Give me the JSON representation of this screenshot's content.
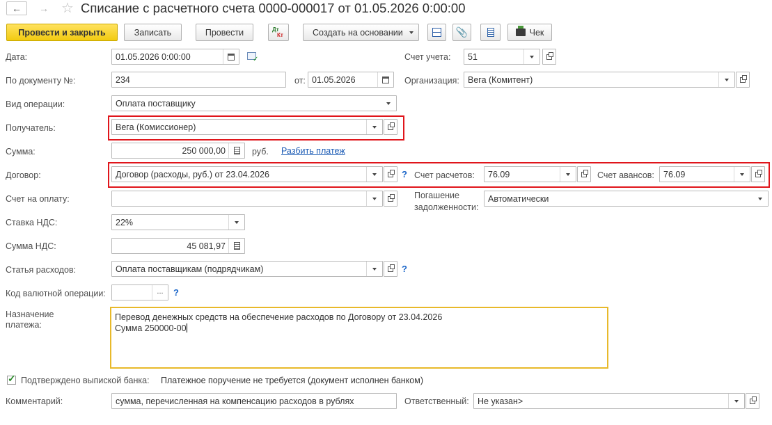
{
  "title": "Списание с расчетного счета 0000-000017 от 01.05.2026 0:00:00",
  "toolbar": {
    "post_close": "Провести и закрыть",
    "save": "Записать",
    "post": "Провести",
    "dtkt_dt": "Дт",
    "dtkt_kt": "Кт",
    "create_based": "Создать на основании",
    "check": "Чек"
  },
  "form": {
    "date_label": "Дата:",
    "date_value": "01.05.2026  0:00:00",
    "account_label": "Счет учета:",
    "account_value": "51",
    "docnum_label": "По документу №:",
    "docnum_value": "234",
    "from_label": "от:",
    "from_value": "01.05.2026",
    "org_label": "Организация:",
    "org_value": "Вега (Комитент)",
    "optype_label": "Вид операции:",
    "optype_value": "Оплата поставщику",
    "recipient_label": "Получатель:",
    "recipient_value": "Вега (Комиссионер)",
    "sum_label": "Сумма:",
    "sum_value": "250 000,00",
    "sum_currency": "руб.",
    "split_link": "Разбить платеж",
    "contract_label": "Договор:",
    "contract_value": "Договор (расходы, руб.) от 23.04.2026",
    "settle_label": "Счет расчетов:",
    "settle_value": "76.09",
    "advance_label": "Счет авансов:",
    "advance_value": "76.09",
    "invoice_label": "Счет на оплату:",
    "invoice_value": "",
    "debt_label_1": "Погашение",
    "debt_label_2": "задолженности:",
    "debt_value": "Автоматически",
    "vat_rate_label": "Ставка НДС:",
    "vat_rate_value": "22%",
    "vat_sum_label": "Сумма НДС:",
    "vat_sum_value": "45 081,97",
    "expense_label": "Статья расходов:",
    "expense_value": "Оплата поставщикам (подрядчикам)",
    "currency_op_label": "Код валютной операции:",
    "currency_op_value": "",
    "purpose_label_1": "Назначение",
    "purpose_label_2": "платежа:",
    "purpose_line1": "Перевод денежных средств на обеспечение расходов по Договору от 23.04.2026",
    "purpose_line2": "Сумма 250000-00",
    "confirmed_label": "Подтверждено выпиской банка:",
    "confirmed_text": "Платежное поручение не требуется (документ исполнен банком)",
    "comment_label": "Комментарий:",
    "comment_value": "сумма, перечисленная на компенсацию расходов в рублях",
    "responsible_label": "Ответственный:",
    "responsible_value": "Не указан>",
    "qmark": "?",
    "ellipsis": "..."
  },
  "colors": {
    "primary_button": "#f5d21c",
    "highlight_box": "#e0151b",
    "focus_border": "#e8b92a",
    "link": "#1b5bb5"
  }
}
